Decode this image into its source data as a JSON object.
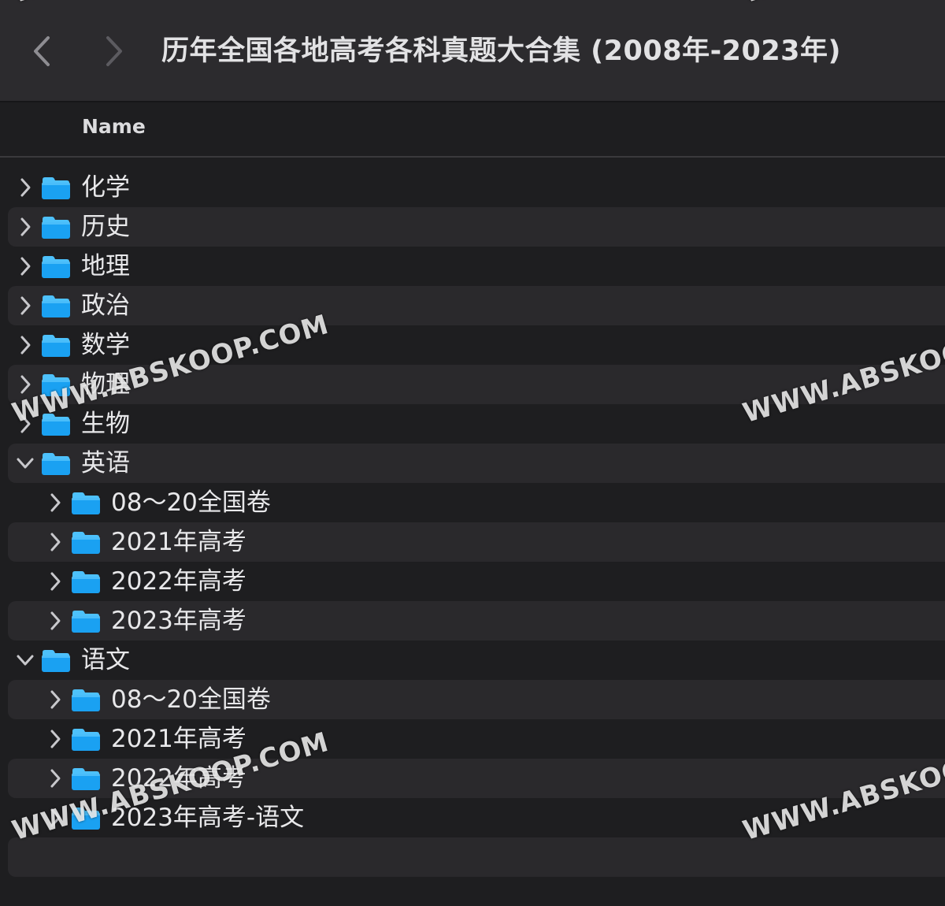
{
  "window": {
    "title": "历年全国各地高考各科真题大合集 (2008年-2023年)"
  },
  "toolbar": {
    "back_icon": "chevron-left-icon",
    "forward_icon": "chevron-right-icon"
  },
  "columns": {
    "name": "Name"
  },
  "colors": {
    "folder": "#1aa1f2",
    "folder_tab": "#4dc1fb",
    "row_alt": "#2a292c",
    "background": "#1e1e20"
  },
  "items": [
    {
      "label": "化学",
      "level": 0,
      "expanded": false
    },
    {
      "label": "历史",
      "level": 0,
      "expanded": false
    },
    {
      "label": "地理",
      "level": 0,
      "expanded": false
    },
    {
      "label": "政治",
      "level": 0,
      "expanded": false
    },
    {
      "label": "数学",
      "level": 0,
      "expanded": false
    },
    {
      "label": "物理",
      "level": 0,
      "expanded": false
    },
    {
      "label": "生物",
      "level": 0,
      "expanded": false
    },
    {
      "label": "英语",
      "level": 0,
      "expanded": true
    },
    {
      "label": "08～20全国卷",
      "level": 1,
      "expanded": false
    },
    {
      "label": "2021年高考",
      "level": 1,
      "expanded": false
    },
    {
      "label": "2022年高考",
      "level": 1,
      "expanded": false
    },
    {
      "label": "2023年高考",
      "level": 1,
      "expanded": false
    },
    {
      "label": "语文",
      "level": 0,
      "expanded": true
    },
    {
      "label": "08～20全国卷",
      "level": 1,
      "expanded": false
    },
    {
      "label": "2021年高考",
      "level": 1,
      "expanded": false
    },
    {
      "label": "2022年高考",
      "level": 1,
      "expanded": false
    },
    {
      "label": "2023年高考-语文",
      "level": 1,
      "expanded": false
    }
  ],
  "watermarks": [
    "WWW.ABSKOOP.COM",
    "WWW.ABSKOOP.COM",
    "WWW.ABSKOOP.COM",
    "WWW.ABSKOOP.COM",
    "WWW.",
    "WWW."
  ]
}
